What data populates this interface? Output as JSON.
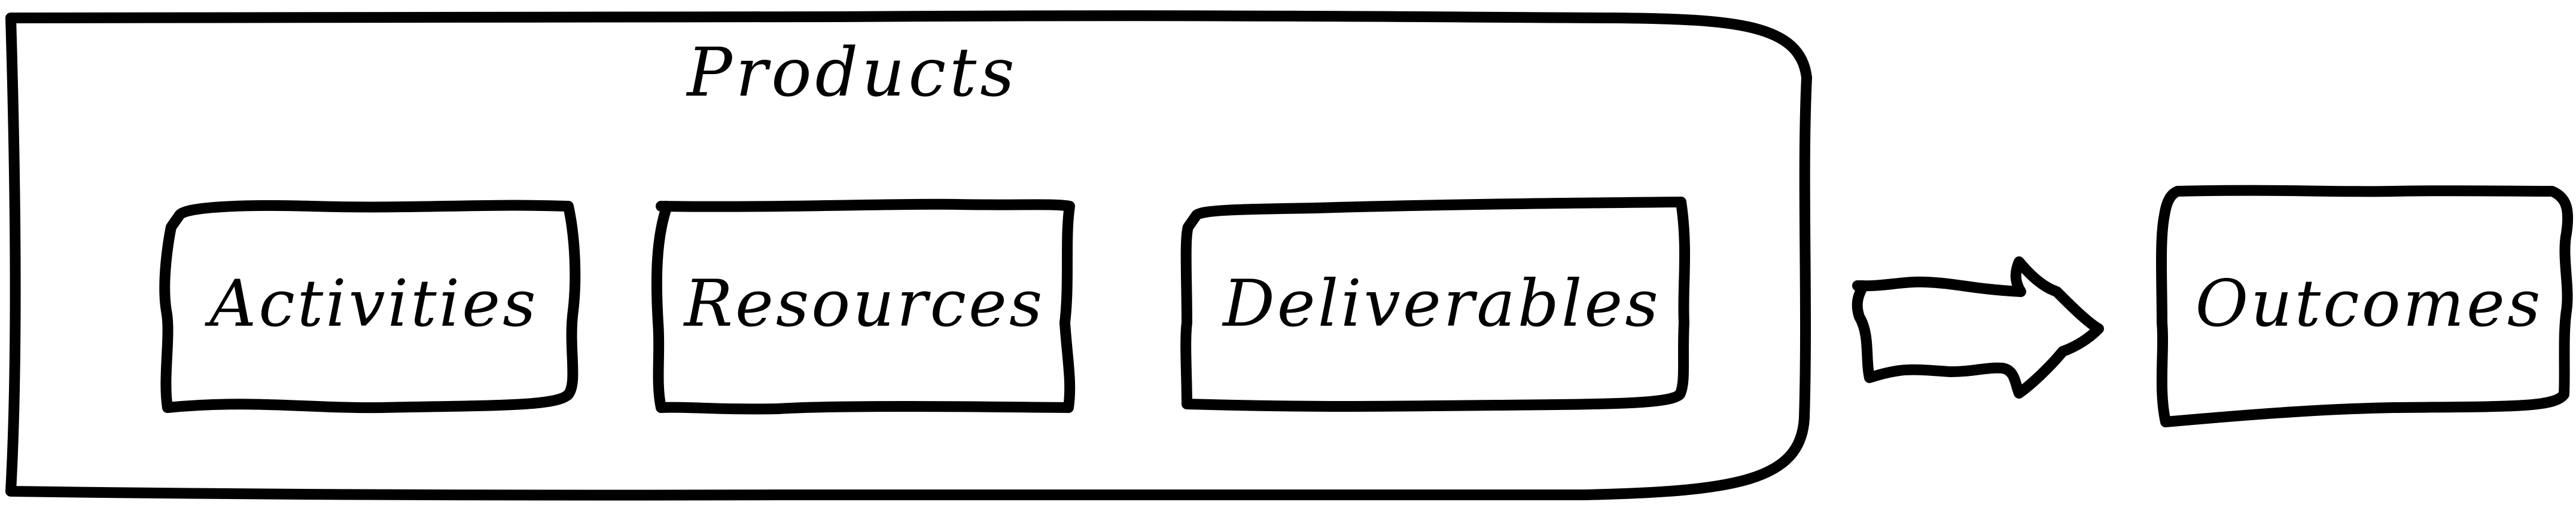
{
  "container": {
    "title": "Products",
    "items": [
      {
        "label": "Activities"
      },
      {
        "label": "Resources"
      },
      {
        "label": "Deliverables"
      }
    ]
  },
  "arrow": {
    "icon": "right-arrow-icon"
  },
  "outcome": {
    "label": "Outcomes"
  }
}
